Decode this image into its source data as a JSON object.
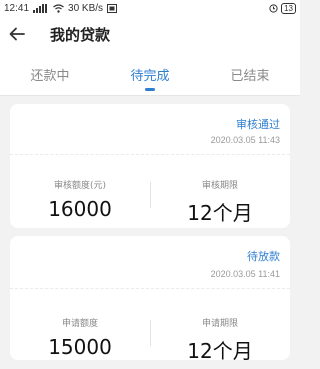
{
  "status_bar": {
    "time": "12:41",
    "speed": "30 KB/s",
    "battery": "13"
  },
  "header": {
    "title": "我的贷款"
  },
  "tabs": [
    {
      "label": "还款中",
      "active": false
    },
    {
      "label": "待完成",
      "active": true
    },
    {
      "label": "已结束",
      "active": false
    }
  ],
  "loans": [
    {
      "status": "审核通过",
      "time": "2020.03.05 11:43",
      "amount_label": "审核额度(元)",
      "amount": "16000",
      "term_label": "审核期限",
      "term": "12个月"
    },
    {
      "status": "待放款",
      "time": "2020.03.05 11:41",
      "amount_label": "申请额度",
      "amount": "15000",
      "term_label": "申请期限",
      "term": "12个月"
    }
  ],
  "colors": {
    "accent": "#2f7fd1",
    "background": "#f2f2f2",
    "card": "#ffffff"
  },
  "icons": {
    "back": "arrow-left-icon",
    "signal": "signal-icon",
    "wifi": "wifi-icon",
    "battery": "battery-icon"
  }
}
